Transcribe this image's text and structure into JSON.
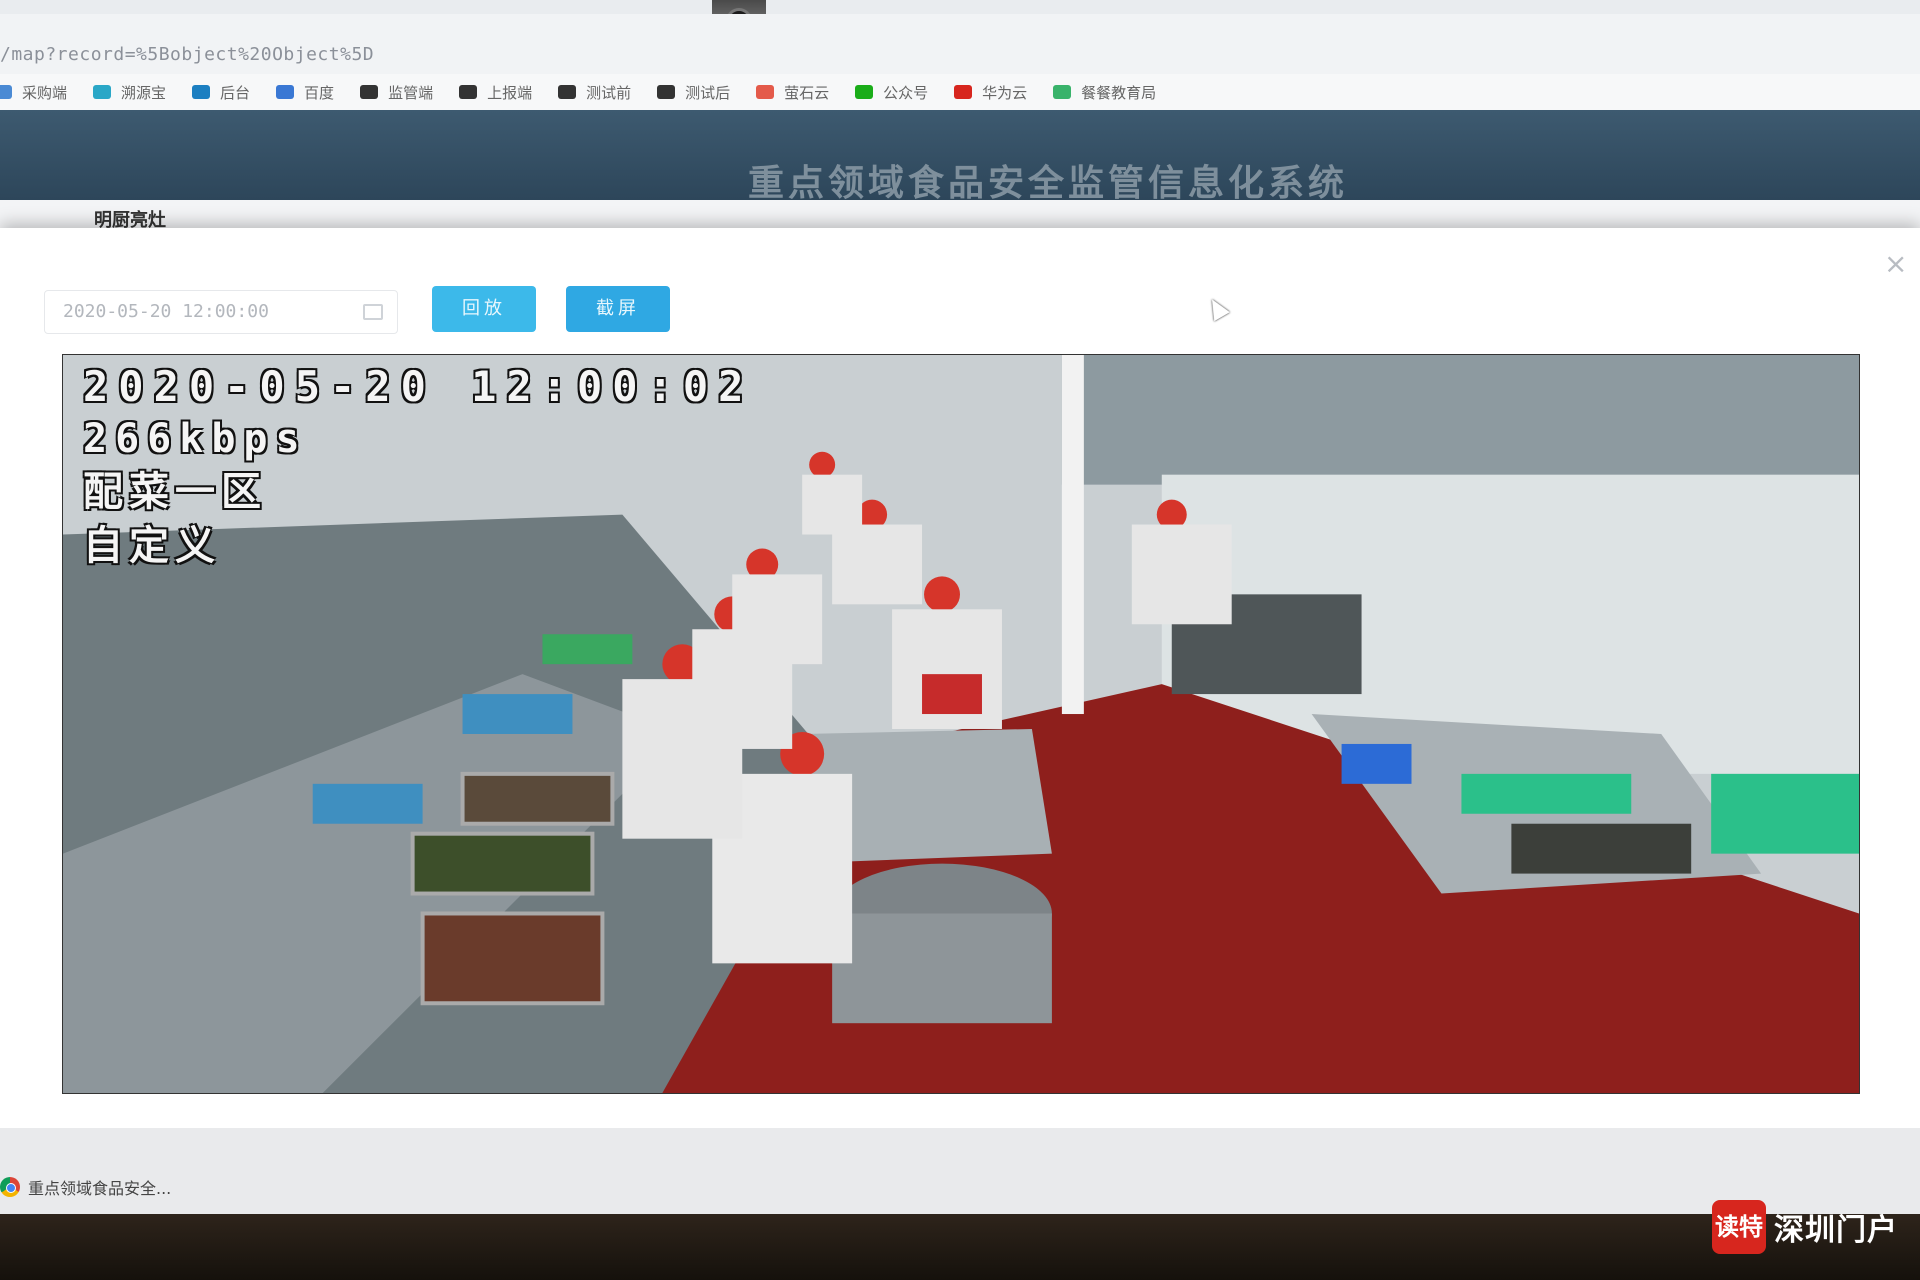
{
  "browser": {
    "url": "/map?record=%5Bobject%20Object%5D",
    "bookmarks": [
      {
        "label": "采购端",
        "icon": "bookmark-icon",
        "color": "#4a8ad4"
      },
      {
        "label": "溯源宝",
        "icon": "leaf-icon",
        "color": "#2aa7c7"
      },
      {
        "label": "后台",
        "icon": "dashboard-icon",
        "color": "#1c7fc1"
      },
      {
        "label": "百度",
        "icon": "baidu-paw-icon",
        "color": "#3a78d4"
      },
      {
        "label": "监管端",
        "icon": "link-icon",
        "color": "#333333"
      },
      {
        "label": "上报端",
        "icon": "link-icon",
        "color": "#333333"
      },
      {
        "label": "测试前",
        "icon": "link-icon",
        "color": "#333333"
      },
      {
        "label": "测试后",
        "icon": "link-icon",
        "color": "#333333"
      },
      {
        "label": "萤石云",
        "icon": "grid-icon",
        "color": "#e45a4a"
      },
      {
        "label": "公众号",
        "icon": "wechat-icon",
        "color": "#1aad19"
      },
      {
        "label": "华为云",
        "icon": "huawei-icon",
        "color": "#d7261e"
      },
      {
        "label": "餐餐教育局",
        "icon": "shield-icon",
        "color": "#39b36b"
      }
    ]
  },
  "header": {
    "title": "重点领域食品安全监管信息化系统",
    "behind_label": "明厨亮灶"
  },
  "modal": {
    "close_label": "×",
    "date_value": "2020-05-20 12:00:00",
    "replay_label": "回放",
    "screenshot_label": "截屏"
  },
  "video": {
    "timestamp": "2020-05-20 12:00:02",
    "bitrate": "266kbps",
    "zone": "配菜一区",
    "mode": "自定义"
  },
  "taskbar": {
    "tab_label": "重点领域食品安全..."
  },
  "watermark": {
    "badge": "读特",
    "text": "深圳门户"
  },
  "colors": {
    "header_bg": "#2d465a",
    "button": "#35b4e6",
    "floor": "#8e1f1c"
  }
}
